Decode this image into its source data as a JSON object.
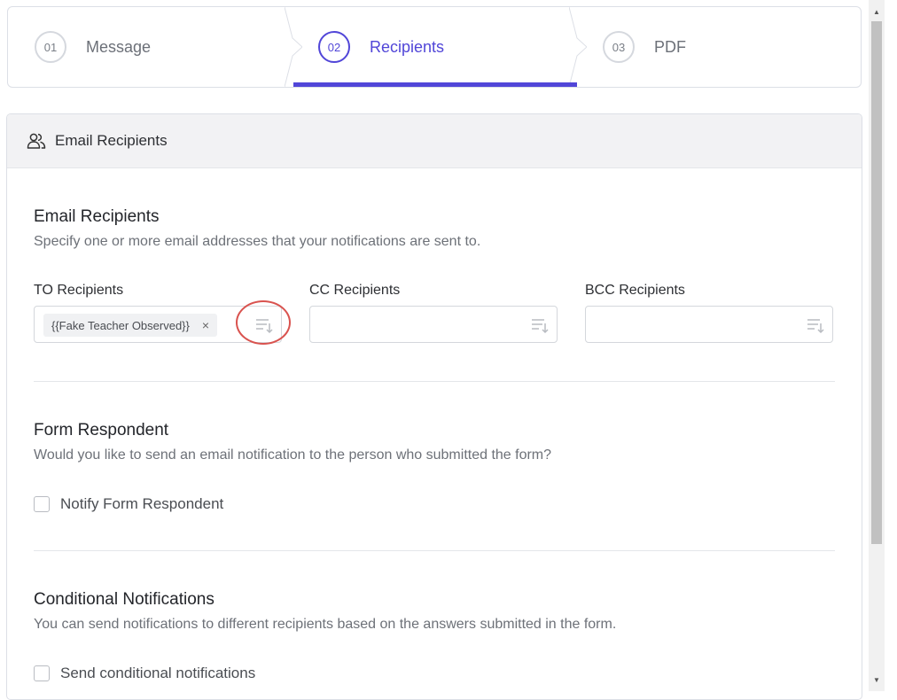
{
  "stepper": {
    "steps": [
      {
        "number": "01",
        "label": "Message",
        "active": false
      },
      {
        "number": "02",
        "label": "Recipients",
        "active": true
      },
      {
        "number": "03",
        "label": "PDF",
        "active": false
      }
    ],
    "accent_color": "#5146d8"
  },
  "card": {
    "header_title": "Email Recipients",
    "header_icon": "users-icon"
  },
  "email_recipients": {
    "title": "Email Recipients",
    "description": "Specify one or more email addresses that your notifications are sent to.",
    "to": {
      "label": "TO Recipients",
      "tags": [
        "{{Fake Teacher Observed}}"
      ],
      "remove_glyph": "×"
    },
    "cc": {
      "label": "CC Recipients",
      "value": ""
    },
    "bcc": {
      "label": "BCC Recipients",
      "value": ""
    },
    "field_icon": "sort-descending-icon"
  },
  "form_respondent": {
    "title": "Form Respondent",
    "description": "Would you like to send an email notification to the person who submitted the form?",
    "checkbox_label": "Notify Form Respondent",
    "checked": false
  },
  "conditional": {
    "title": "Conditional Notifications",
    "description": "You can send notifications to different recipients based on the answers submitted in the form.",
    "checkbox_label": "Send conditional notifications",
    "checked": false
  },
  "scrollbar": {
    "up_glyph": "▲",
    "down_glyph": "▼"
  }
}
